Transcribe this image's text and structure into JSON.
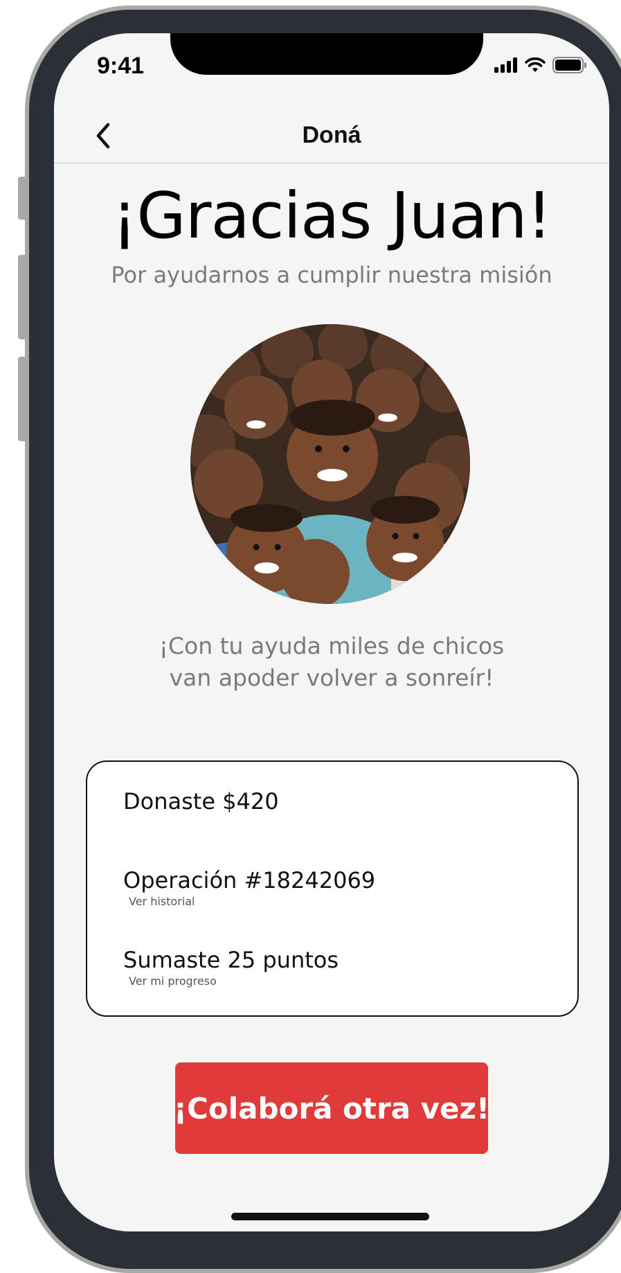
{
  "status_bar": {
    "time": "9:41"
  },
  "nav": {
    "title": "Doná",
    "back_icon": "chevron-left-icon"
  },
  "hero": {
    "title": "¡Gracias Juan!",
    "subtitle": "Por ayudarnos a cumplir nuestra misión"
  },
  "photo": {
    "subject": "group of smiling children"
  },
  "mission": {
    "line1": "¡Con tu ayuda miles de chicos",
    "line2": "van apoder volver a sonreír!"
  },
  "summary": {
    "donation": "Donaste $420",
    "operation": "Operación #18242069",
    "operation_link": "Ver historial",
    "points": "Sumaste 25 puntos",
    "points_link": "Ver mi progreso"
  },
  "cta": {
    "label": "¡Colaborá otra vez!"
  },
  "colors": {
    "accent": "#e03a3a",
    "background": "#f5f5f5",
    "muted_text": "#7a7a7a"
  }
}
